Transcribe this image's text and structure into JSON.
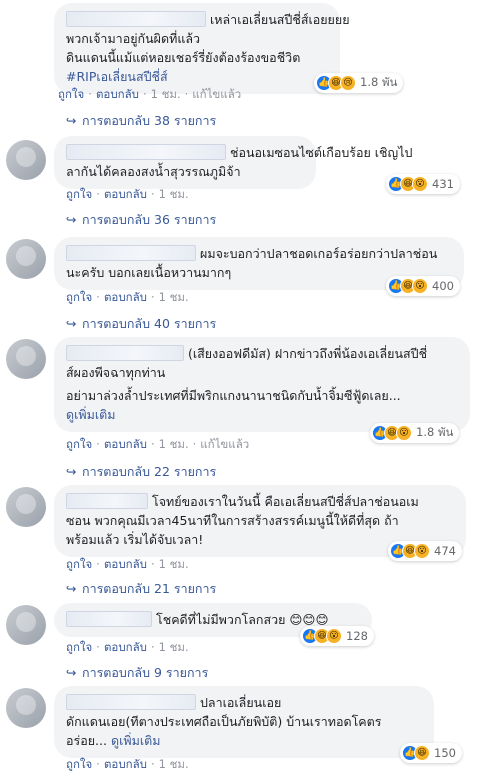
{
  "colors": {
    "link": "#385898",
    "bubble": "#f2f3f5",
    "meta": "#90949c",
    "like": "#1877f2",
    "emoji": "#f7b125"
  },
  "comments": [
    {
      "lines": [
        "เหล่าเอเลี่ยนสปีชี่ส์เอยยยย",
        "พวกเจ้ามาอยู่กันผิดที่แล้ว",
        "ดินแดนนี้แม้แต่หอยเชอร์รี่ยังต้องร้องขอชีวิต"
      ],
      "hashtag": "#RIPเอเลี่ยนสปีชี่ส์",
      "reactions": {
        "icons": [
          "like-icon",
          "haha-icon",
          "sad-icon"
        ],
        "count": "1.8 พัน"
      },
      "actions": {
        "like": "ถูกใจ",
        "reply": "ตอบกลับ",
        "time": "1 ชม.",
        "edited": "แก้ไขแล้ว"
      },
      "replies": "การตอบกลับ 38 รายการ"
    },
    {
      "lines": [
        "ช่อนอเมซอนไซต์เกือบร้อย เชิญไป",
        "ลากันได้คลองสงน้ำสุวรรณภูมิจ้า"
      ],
      "reactions": {
        "icons": [
          "like-icon",
          "haha-icon",
          "wow-icon"
        ],
        "count": "431"
      },
      "actions": {
        "like": "ถูกใจ",
        "reply": "ตอบกลับ",
        "time": "1 ชม."
      },
      "replies": "การตอบกลับ 36 รายการ"
    },
    {
      "lines": [
        "ผมจะบอกว่าปลาชอดเกอร์อร่อยกว่าปลาช่อน",
        "นะครับ บอกเลยเนื้อหวานมากๆ"
      ],
      "reactions": {
        "icons": [
          "like-icon",
          "haha-icon",
          "wow-icon"
        ],
        "count": "400"
      },
      "actions": {
        "like": "ถูกใจ",
        "reply": "ตอบกลับ",
        "time": "1 ชม."
      },
      "replies": "การตอบกลับ 40 รายการ"
    },
    {
      "lines": [
        "(เสียงออฟดีมัส) ฝากข่าวถึงพี่น้องเอเลี่ยนสปีชี่",
        "ส์ผองพีจฉาทุกท่าน",
        "อย่ามาล่วงล้ำประเทศที่มีพริกแกงนานาชนิดกับน้ำจิ้มซีฟู้ดเลย..."
      ],
      "seemore": "ดูเพิ่มเติม",
      "reactions": {
        "icons": [
          "like-icon",
          "haha-icon",
          "wow-icon"
        ],
        "count": "1.8 พัน"
      },
      "actions": {
        "like": "ถูกใจ",
        "reply": "ตอบกลับ",
        "time": "1 ชม.",
        "edited": "แก้ไขแล้ว"
      },
      "replies": "การตอบกลับ 22 รายการ"
    },
    {
      "lines": [
        "โจทย์ของเราในวันนี้ คือเอเลี่ยนสปีชี่ส์ปลาช่อนอเม",
        "ซอน พวกคุณมีเวลา45นาทีในการสร้างสรรค์เมนูนี้ให้ดีที่สุด ถ้า",
        "พร้อมแล้ว เริ่มได้จับเวลา!"
      ],
      "reactions": {
        "icons": [
          "like-icon",
          "haha-icon",
          "wow-icon"
        ],
        "count": "474"
      },
      "actions": {
        "like": "ถูกใจ",
        "reply": "ตอบกลับ",
        "time": "1 ชม."
      },
      "replies": "การตอบกลับ 21 รายการ"
    },
    {
      "lines": [
        "โชคดีที่ไม่มีพวกโลกสวย 😊😊😊"
      ],
      "reactions": {
        "icons": [
          "like-icon",
          "haha-icon",
          "wow-icon"
        ],
        "count": "128"
      },
      "actions": {
        "like": "ถูกใจ",
        "reply": "ตอบกลับ",
        "time": "1 ชม."
      },
      "replies": "การตอบกลับ 9 รายการ"
    },
    {
      "lines": [
        "ปลาเอเลี่ยนเอย",
        "ดักแดนเอย(ทีตางประเทศถือเป็นภัยพิบัติ) บ้านเราทอดโคตร",
        "อร่อย..."
      ],
      "seemore": "ดูเพิ่มเติม",
      "reactions": {
        "icons": [
          "like-icon",
          "haha-icon"
        ],
        "count": "150"
      },
      "actions": {
        "like": "ถูกใจ",
        "reply": "ตอบกลับ",
        "time": "1 ชม."
      }
    }
  ]
}
